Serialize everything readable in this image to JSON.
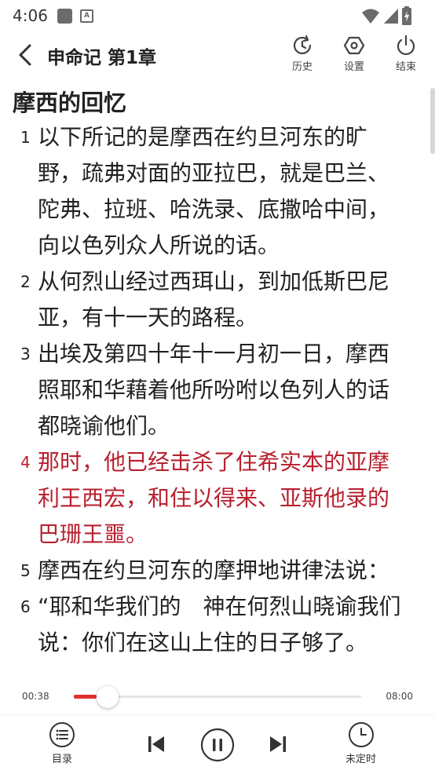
{
  "status": {
    "time": "4:06",
    "notif_letter": "A"
  },
  "header": {
    "title": "申命记 第1章",
    "history_label": "历史",
    "settings_label": "设置",
    "end_label": "结束"
  },
  "content": {
    "heading": "摩西的回忆",
    "verses": [
      {
        "num": "1",
        "text": "以下所记的是摩西在约旦河东的旷野，疏弗对面的亚拉巴，就是巴兰、陀弗、拉班、哈洗录、底撒哈中间，向以色列众人所说的话。"
      },
      {
        "num": "2",
        "text": "从何烈山经过西珥山，到加低斯巴尼亚，有十一天的路程。"
      },
      {
        "num": "3",
        "text": "出埃及第四十年十一月初一日，摩西照耶和华藉着他所吩咐以色列人的话都晓谕他们。"
      },
      {
        "num": "4",
        "text": "那时，他已经击杀了住希实本的亚摩利王西宏，和住以得来、亚斯他录的巴珊王噩。"
      },
      {
        "num": "5",
        "text": "摩西在约旦河东的摩押地讲律法说："
      },
      {
        "num": "6",
        "text": "“耶和华我们的　神在何烈山晓谕我们说：你们在这山上住的日子够了。"
      }
    ]
  },
  "player": {
    "current_time": "00:38",
    "total_time": "08:00",
    "progress": 0.079
  },
  "bottom": {
    "toc_label": "目录",
    "timer_label": "未定时"
  },
  "colors": {
    "highlight": "#b8202e",
    "progress": "#e0302f"
  }
}
